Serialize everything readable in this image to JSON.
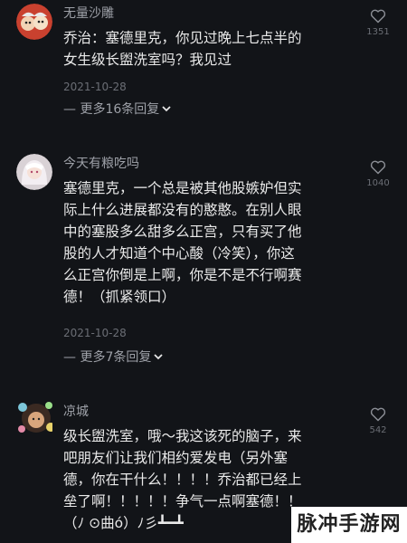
{
  "comments": [
    {
      "username": "无量沙雕",
      "text": "乔治：塞德里克，你见过晚上七点半的\n女生级长盥洗室吗？我见过",
      "date": "2021-10-28",
      "more_replies": "— 更多16条回复",
      "likes": "1351",
      "avatar_icon": "cartoon-characters-avatar"
    },
    {
      "username": "今天有粮吃吗",
      "text": "塞德里克，一个总是被其他股嫉妒但实\n际上什么进展都没有的憨憨。在别人眼\n中的塞股多么甜多么正宫，只有买了他\n股的人才知道个中心酸（冷笑），你这\n么正宫你倒是上啊，你是不是不行啊赛\n德！（抓紧领口）",
      "date": "2021-10-28",
      "more_replies": "— 更多7条回复",
      "likes": "1040",
      "avatar_icon": "anime-girl-avatar"
    },
    {
      "username": "凉城",
      "text": "级长盥洗室，哦～我这该死的脑子，来\n吧朋友们让我们相约爱发电（另外塞\n德，你在干什么！！！！乔治都已经上\n垒了啊！！！！！争气一点啊塞德！！\n（ﾉ ⊙曲ó）ﾉ彡┻━┻",
      "likes": "542",
      "avatar_icon": "character-with-flowers-avatar"
    }
  ],
  "watermark": "脉冲手游网",
  "colors": {
    "background": "#121418",
    "text": "#eaeaea",
    "muted": "#9ea1a8",
    "date": "#6b6e75"
  }
}
